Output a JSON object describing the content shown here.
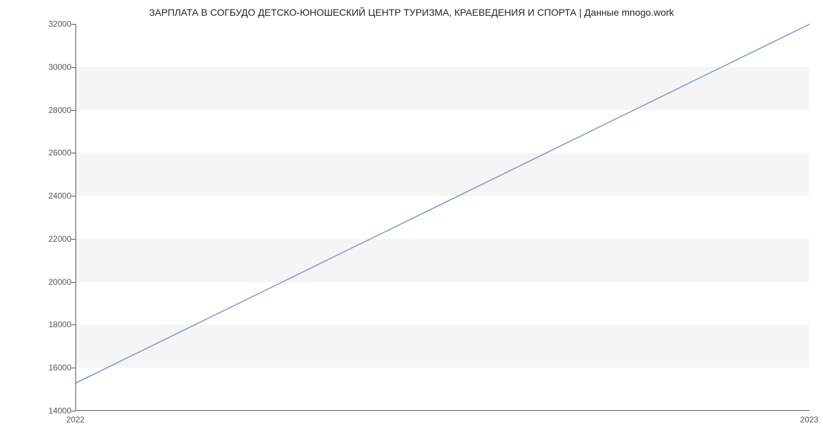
{
  "chart_data": {
    "type": "line",
    "title": "ЗАРПЛАТА В СОГБУДО ДЕТСКО-ЮНОШЕСКИЙ ЦЕНТР ТУРИЗМА, КРАЕВЕДЕНИЯ И СПОРТА | Данные mnogo.work",
    "x": [
      2022,
      2023
    ],
    "series": [
      {
        "name": "salary",
        "values": [
          15300,
          32000
        ]
      }
    ],
    "xlabel": "",
    "ylabel": "",
    "ylim": [
      14000,
      32000
    ],
    "y_ticks": [
      14000,
      16000,
      18000,
      20000,
      22000,
      24000,
      26000,
      28000,
      30000,
      32000
    ],
    "x_ticks": [
      2022,
      2023
    ],
    "plot_bands": [
      [
        16000,
        18000
      ],
      [
        20000,
        22000
      ],
      [
        24000,
        26000
      ],
      [
        28000,
        30000
      ]
    ]
  }
}
